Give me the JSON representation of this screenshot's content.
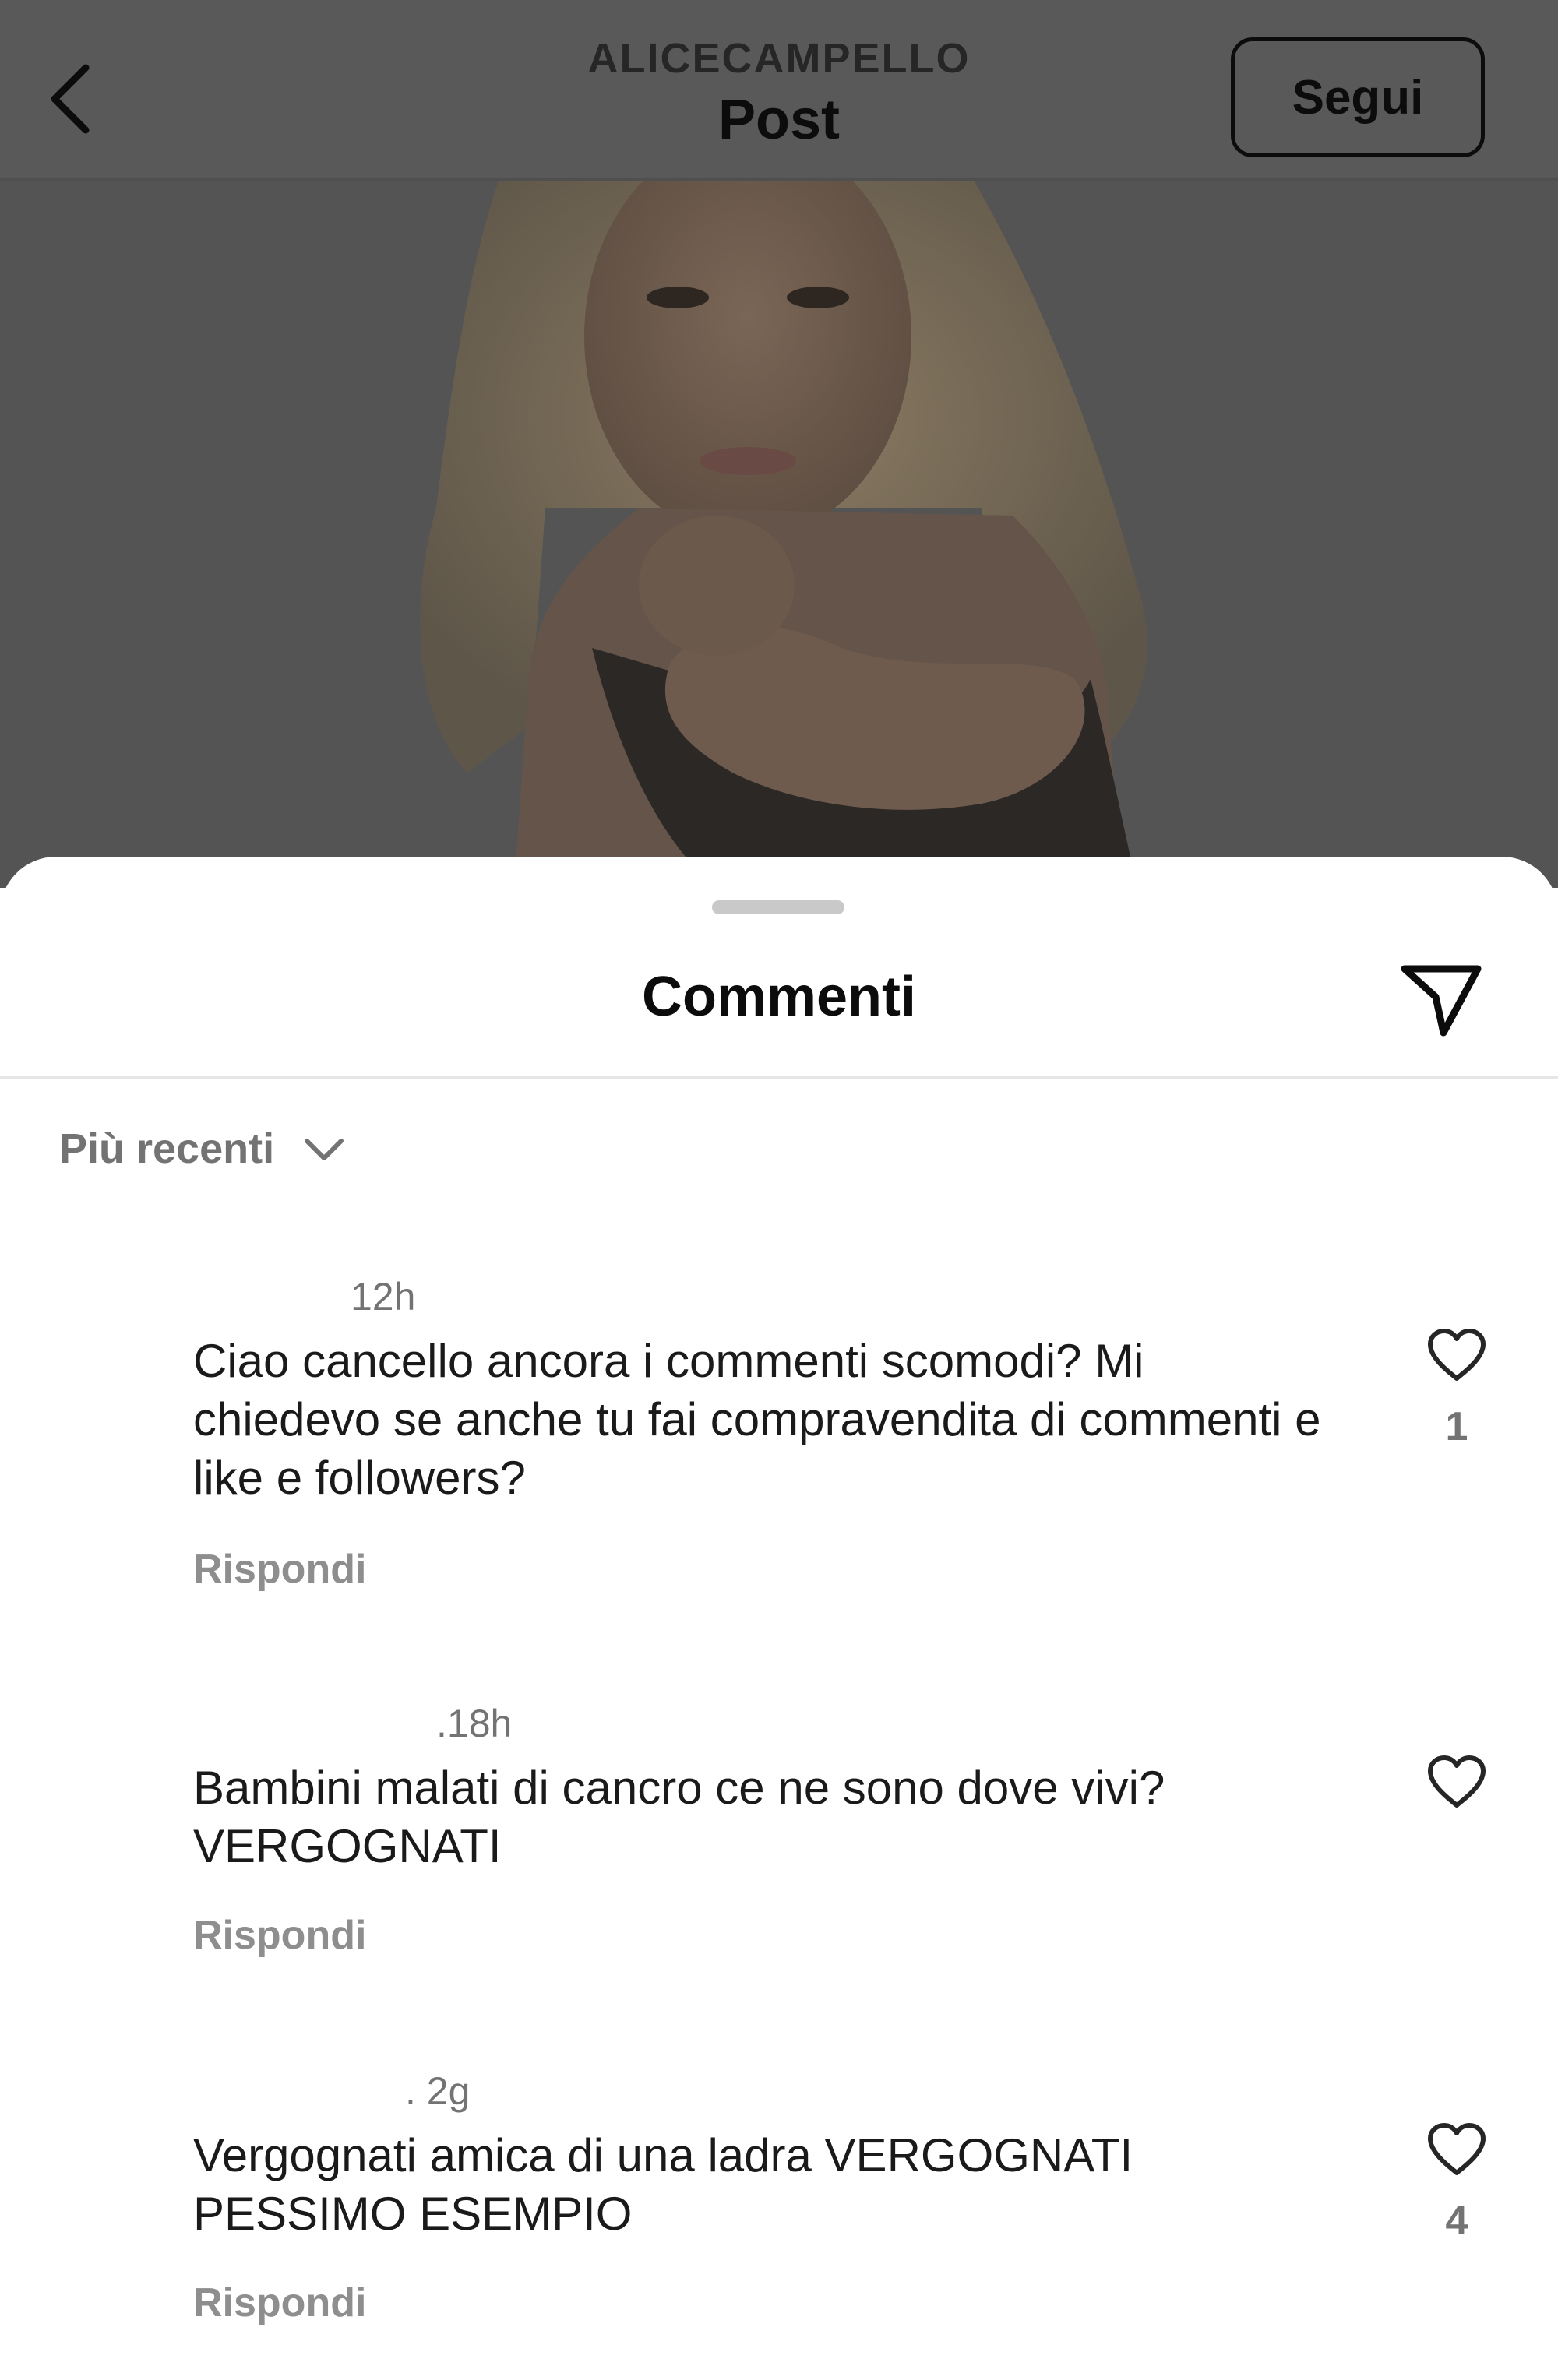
{
  "header": {
    "username": "ALICECAMPELLO",
    "title": "Post",
    "follow_label": "Segui"
  },
  "sheet": {
    "title": "Commenti",
    "sort_label": "Più recenti"
  },
  "comments": [
    {
      "time": "12h",
      "text": "Ciao cancello ancora i commenti scomodi? Mi chiedevo se anche tu fai compravendita  di commenti e like e followers?",
      "reply_label": "Rispondi",
      "likes": "1"
    },
    {
      "time": ".18h",
      "text": "Bambini malati di cancro ce ne sono dove vivi? VERGOGNATI",
      "reply_label": "Rispondi",
      "likes": ""
    },
    {
      "time": ". 2g",
      "text": "Vergognati amica di una ladra VERGOGNATI PESSIMO ESEMPIO",
      "reply_label": "Rispondi",
      "likes": "4"
    }
  ],
  "icons": {
    "back": "chevron-left-icon",
    "share": "paper-plane-icon",
    "sort": "chevron-down-icon",
    "like": "heart-outline-icon"
  },
  "colors": {
    "overlay": "#505050",
    "text_primary": "#0c0c0c",
    "text_secondary": "#737373",
    "sheet_background": "#ffffff"
  }
}
